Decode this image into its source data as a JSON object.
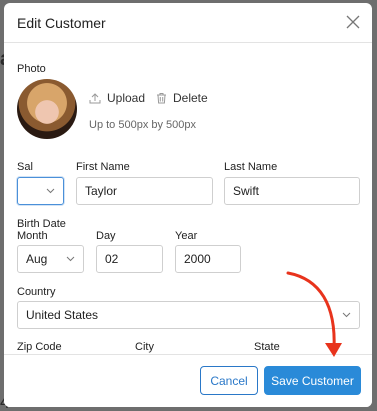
{
  "background": {
    "letter_top": "a",
    "letter_bottom": "4"
  },
  "modal": {
    "title": "Edit Customer",
    "photo_label": "Photo",
    "upload_label": "Upload",
    "delete_label": "Delete",
    "photo_hint": "Up to 500px by 500px",
    "sal_label": "Sal",
    "sal_value": "",
    "first_name_label": "First Name",
    "first_name_value": "Taylor",
    "last_name_label": "Last Name",
    "last_name_value": "Swift",
    "birth_date_label": "Birth Date",
    "month_label": "Month",
    "month_value": "Aug",
    "day_label": "Day",
    "day_value": "02",
    "year_label": "Year",
    "year_value": "2000",
    "country_label": "Country",
    "country_value": "United States",
    "zip_label": "Zip Code",
    "city_label": "City",
    "state_label": "State",
    "cancel_label": "Cancel",
    "save_label": "Save Customer"
  },
  "colors": {
    "accent": "#2a8ad8",
    "annotation_arrow": "#e8331c"
  },
  "icons": [
    "close-icon",
    "upload-icon",
    "trash-icon",
    "chevron-down-icon"
  ]
}
